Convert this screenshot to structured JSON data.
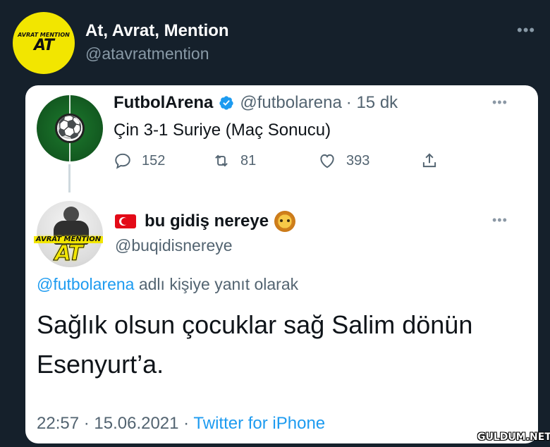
{
  "outer": {
    "logo_big": "AT",
    "logo_small": "AVRAT MENTION",
    "name": "At, Avrat, Mention",
    "handle": "@atavratmention",
    "more_icon": "more-horizontal-icon",
    "more_glyph": "•••"
  },
  "quoted": {
    "name": "FutbolArena",
    "handle": "@futbolarena",
    "time": "· 15 dk",
    "text": "Çin 3-1 Suriye (Maç Sonucu)",
    "more_glyph": "•••",
    "actions": {
      "reply_count": "152",
      "retweet_count": "81",
      "like_count": "393"
    },
    "verified_color": "#1d9bf0"
  },
  "reply": {
    "name": "bu gidiş nereye",
    "handle": "@buqidisnereye",
    "logo_big": "AT",
    "logo_small": "AVRAT MENTION",
    "more_glyph": "•••",
    "replying_link": "@futbolarena",
    "replying_rest": " adlı kişiye yanıt olarak",
    "text": "Sağlık olsun çocuklar sağ Salim dönün Esenyurt’a.",
    "time": "22:57 · 15.06.2021 · ",
    "source": "Twitter for iPhone"
  },
  "watermark": "GULDUM.NET",
  "colors": {
    "background": "#15202b",
    "card": "#ffffff",
    "link": "#1d9bf0",
    "secondary_text": "#536471",
    "logo_yellow": "#f2e600"
  }
}
